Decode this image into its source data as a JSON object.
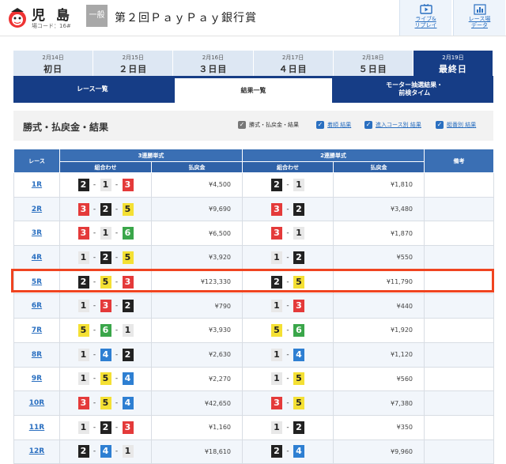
{
  "header": {
    "venue_name": "児 島",
    "venue_code": "場コード：16#",
    "grade": "一般",
    "race_title": "第２回ＰａｙＰａｙ銀行賞",
    "live_label_1": "ライブ&",
    "live_label_2": "リプレイ",
    "data_label_1": "レース場",
    "data_label_2": "データ"
  },
  "days": [
    {
      "date": "2月14日",
      "name": "初日"
    },
    {
      "date": "2月15日",
      "name": "２日目"
    },
    {
      "date": "2月16日",
      "name": "３日目"
    },
    {
      "date": "2月17日",
      "name": "４日目"
    },
    {
      "date": "2月18日",
      "name": "５日目"
    },
    {
      "date": "2月19日",
      "name": "最終日"
    }
  ],
  "subtabs": {
    "race_list": "レース一覧",
    "results": "結果一覧",
    "motor_line1": "モーター抽選結果・",
    "motor_line2": "前検タイム"
  },
  "section": {
    "title": "勝式・払戻金・結果",
    "opt1": "勝式・払戻金・結果",
    "opt2": "着順 結果",
    "opt3": "進入コース別 結果",
    "opt4": "艇番別 結果"
  },
  "table": {
    "h_race": "レース",
    "h_trifecta": "3連勝単式",
    "h_exacta": "2連勝単式",
    "h_note": "備考",
    "h_combo": "組合わせ",
    "h_payout": "払戻金",
    "rows": [
      {
        "race": "1R",
        "tri": [
          2,
          1,
          3
        ],
        "tri_pay": "¥4,500",
        "ex": [
          2,
          1
        ],
        "ex_pay": "¥1,810"
      },
      {
        "race": "2R",
        "tri": [
          3,
          2,
          5
        ],
        "tri_pay": "¥9,690",
        "ex": [
          3,
          2
        ],
        "ex_pay": "¥3,480"
      },
      {
        "race": "3R",
        "tri": [
          3,
          1,
          6
        ],
        "tri_pay": "¥6,500",
        "ex": [
          3,
          1
        ],
        "ex_pay": "¥1,870"
      },
      {
        "race": "4R",
        "tri": [
          1,
          2,
          5
        ],
        "tri_pay": "¥3,920",
        "ex": [
          1,
          2
        ],
        "ex_pay": "¥550"
      },
      {
        "race": "5R",
        "tri": [
          2,
          5,
          3
        ],
        "tri_pay": "¥123,330",
        "ex": [
          2,
          5
        ],
        "ex_pay": "¥11,790"
      },
      {
        "race": "6R",
        "tri": [
          1,
          3,
          2
        ],
        "tri_pay": "¥790",
        "ex": [
          1,
          3
        ],
        "ex_pay": "¥440"
      },
      {
        "race": "7R",
        "tri": [
          5,
          6,
          1
        ],
        "tri_pay": "¥3,930",
        "ex": [
          5,
          6
        ],
        "ex_pay": "¥1,920"
      },
      {
        "race": "8R",
        "tri": [
          1,
          4,
          2
        ],
        "tri_pay": "¥2,630",
        "ex": [
          1,
          4
        ],
        "ex_pay": "¥1,120"
      },
      {
        "race": "9R",
        "tri": [
          1,
          5,
          4
        ],
        "tri_pay": "¥2,270",
        "ex": [
          1,
          5
        ],
        "ex_pay": "¥560"
      },
      {
        "race": "10R",
        "tri": [
          3,
          5,
          4
        ],
        "tri_pay": "¥42,650",
        "ex": [
          3,
          5
        ],
        "ex_pay": "¥7,380"
      },
      {
        "race": "11R",
        "tri": [
          1,
          2,
          3
        ],
        "tri_pay": "¥1,160",
        "ex": [
          1,
          2
        ],
        "ex_pay": "¥350"
      },
      {
        "race": "12R",
        "tri": [
          2,
          4,
          1
        ],
        "tri_pay": "¥18,610",
        "ex": [
          2,
          4
        ],
        "ex_pay": "¥9,960"
      }
    ]
  },
  "colors": {
    "boat_1": "#e8e8e8",
    "boat_2": "#222222",
    "boat_3": "#e43a3a",
    "boat_4": "#2e7fd2",
    "boat_5": "#f4e034",
    "boat_6": "#3aa64a",
    "accent": "#163d86",
    "highlight": "#f04420"
  }
}
